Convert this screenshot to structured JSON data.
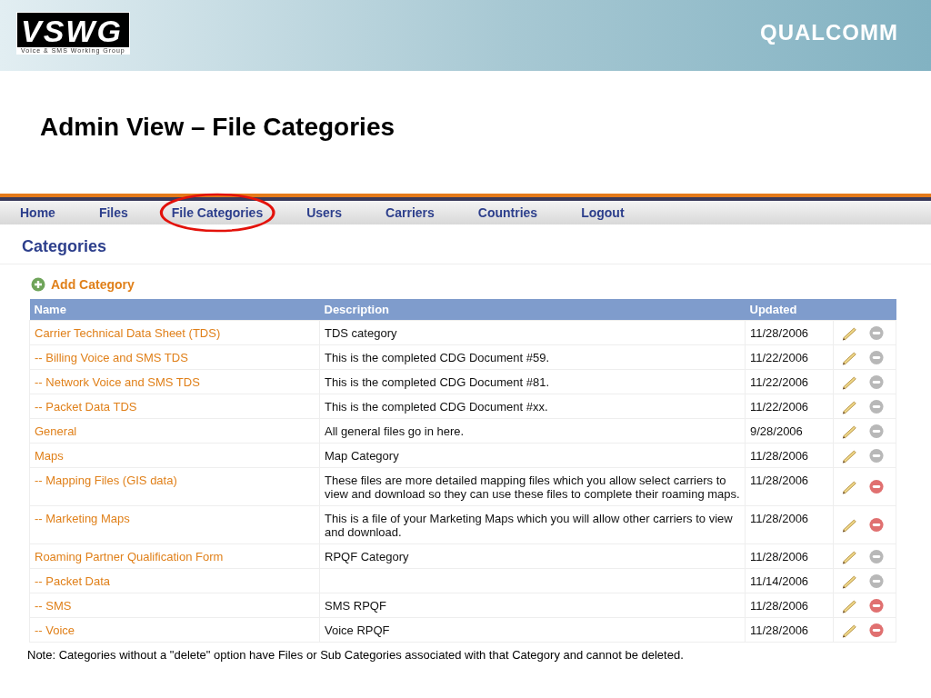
{
  "header": {
    "logo_text": "VSWG",
    "logo_subtitle": "Voice & SMS Working Group",
    "brand": "QUALCOMM"
  },
  "slide_title": "Admin View – File Categories",
  "nav": [
    {
      "label": "Home",
      "highlighted": false
    },
    {
      "label": "Files",
      "highlighted": false
    },
    {
      "label": "File Categories",
      "highlighted": true
    },
    {
      "label": "Users",
      "highlighted": false
    },
    {
      "label": "Carriers",
      "highlighted": false
    },
    {
      "label": "Countries",
      "highlighted": false
    },
    {
      "label": "Logout",
      "highlighted": false
    }
  ],
  "page_heading": "Categories",
  "add_link": "Add Category",
  "table": {
    "columns": [
      "Name",
      "Description",
      "Updated"
    ],
    "rows": [
      {
        "name": "Carrier Technical Data Sheet (TDS)",
        "description": "TDS category",
        "updated": "11/28/2006",
        "deletable": false
      },
      {
        "name": "-- Billing Voice and SMS TDS",
        "description": "This is the completed CDG Document #59.",
        "updated": "11/22/2006",
        "deletable": false
      },
      {
        "name": "-- Network Voice and SMS TDS",
        "description": "This is the completed CDG Document #81.",
        "updated": "11/22/2006",
        "deletable": false
      },
      {
        "name": "-- Packet Data TDS",
        "description": "This is the completed CDG Document #xx.",
        "updated": "11/22/2006",
        "deletable": false
      },
      {
        "name": "General",
        "description": "All general files go in here.",
        "updated": "9/28/2006",
        "deletable": false
      },
      {
        "name": "Maps",
        "description": "Map Category",
        "updated": "11/28/2006",
        "deletable": false
      },
      {
        "name": "-- Mapping Files (GIS data)",
        "description": "These files are more detailed mapping files which you allow select carriers to view and download so they can use these files to complete their roaming maps.",
        "updated": "11/28/2006",
        "deletable": true
      },
      {
        "name": "-- Marketing Maps",
        "description": "This is a file of your Marketing Maps which you will allow other carriers to view and download.",
        "updated": "11/28/2006",
        "deletable": true
      },
      {
        "name": "Roaming Partner Qualification Form",
        "description": "RPQF Category",
        "updated": "11/28/2006",
        "deletable": false
      },
      {
        "name": "-- Packet Data",
        "description": "",
        "updated": "11/14/2006",
        "deletable": false
      },
      {
        "name": "-- SMS",
        "description": "SMS RPQF",
        "updated": "11/28/2006",
        "deletable": true
      },
      {
        "name": "-- Voice",
        "description": "Voice RPQF",
        "updated": "11/28/2006",
        "deletable": true
      }
    ]
  },
  "note": "Note: Categories without a \"delete\" option have Files or Sub Categories associated with that Category and cannot be deleted."
}
